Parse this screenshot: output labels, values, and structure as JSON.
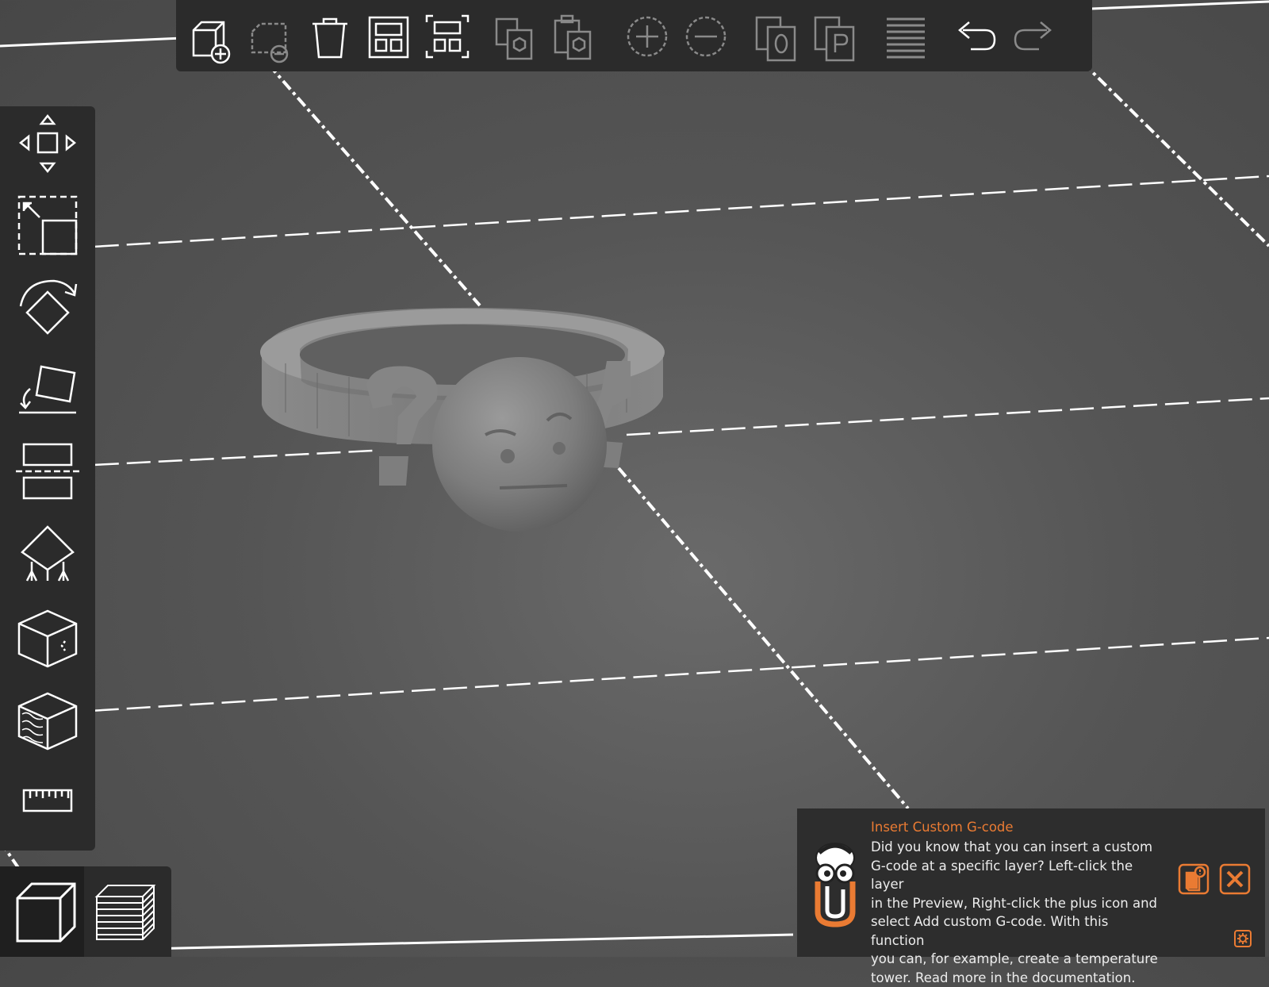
{
  "theme": {
    "accent": "#ea7b33",
    "toolbar_bg": "#2b2b2b",
    "icon_color": "#ffffff",
    "icon_disabled": "#8a8a8a"
  },
  "toolbar": {
    "buttons": [
      {
        "name": "add",
        "icon": "add-object-icon",
        "enabled": true
      },
      {
        "name": "delete",
        "icon": "delete-object-icon",
        "enabled": false
      },
      {
        "name": "delete-all",
        "icon": "trash-icon",
        "enabled": true
      },
      {
        "name": "arrange",
        "icon": "arrange-icon",
        "enabled": true
      },
      {
        "name": "arrange-selection",
        "icon": "arrange-selection-icon",
        "enabled": true
      },
      {
        "name": "copy",
        "icon": "copy-icon",
        "enabled": false
      },
      {
        "name": "paste",
        "icon": "paste-icon",
        "enabled": false
      },
      {
        "name": "add-instance",
        "icon": "plus-circle-icon",
        "enabled": false
      },
      {
        "name": "remove-instance",
        "icon": "minus-circle-icon",
        "enabled": false
      },
      {
        "name": "split-to-objects",
        "icon": "split-objects-icon",
        "enabled": false
      },
      {
        "name": "split-to-parts",
        "icon": "split-parts-icon",
        "enabled": false
      },
      {
        "name": "layers-editing",
        "icon": "layers-icon",
        "enabled": false
      },
      {
        "name": "undo",
        "icon": "undo-icon",
        "enabled": true
      },
      {
        "name": "redo",
        "icon": "redo-icon",
        "enabled": false
      }
    ]
  },
  "sidebar": {
    "tools": [
      {
        "name": "move",
        "icon": "move-icon"
      },
      {
        "name": "scale",
        "icon": "scale-icon"
      },
      {
        "name": "rotate",
        "icon": "rotate-icon"
      },
      {
        "name": "place-on-face",
        "icon": "place-on-face-icon"
      },
      {
        "name": "cut",
        "icon": "cut-icon"
      },
      {
        "name": "support-painting",
        "icon": "support-painting-icon"
      },
      {
        "name": "seam-painting",
        "icon": "seam-painting-icon"
      },
      {
        "name": "fdm-painting",
        "icon": "fdm-painting-icon"
      },
      {
        "name": "measure",
        "icon": "ruler-icon"
      }
    ]
  },
  "view_toggle": {
    "items": [
      {
        "name": "3d-editor-view",
        "icon": "cube-icon",
        "active": true
      },
      {
        "name": "preview",
        "icon": "layers-stack-icon",
        "active": false
      }
    ]
  },
  "hint": {
    "title": "Insert Custom G-code",
    "lines": [
      "Did you know that you can insert a custom",
      "G-code at a specific layer? Left-click the layer",
      "in the Preview, Right-click the plus icon and",
      "select Add custom G-code. With this function",
      "you can, for example, create a temperature",
      "tower. Read more in the documentation."
    ],
    "mascot_icon": "paperclip-mascot-icon",
    "doc_button_icon": "documentation-icon",
    "close_button_icon": "close-icon",
    "settings_icon": "gear-icon"
  }
}
